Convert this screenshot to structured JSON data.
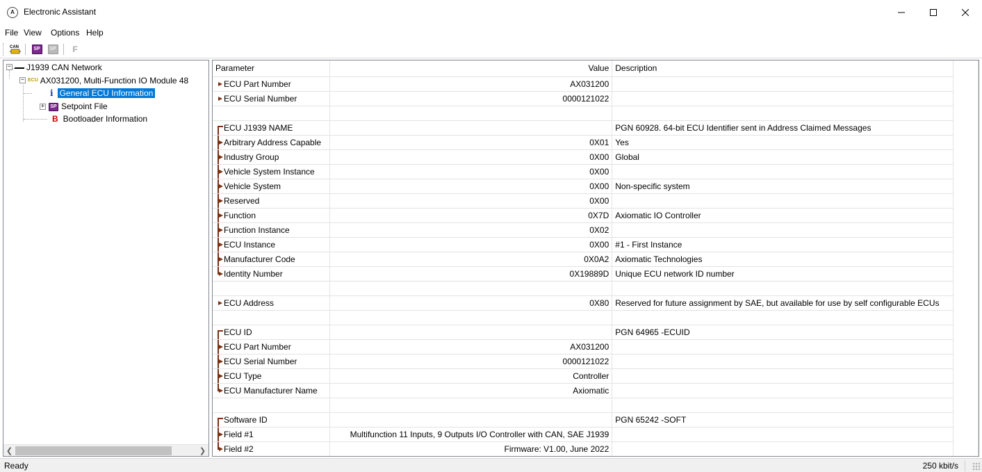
{
  "window": {
    "title": "Electronic Assistant",
    "app_icon": "axiomatic-logo-icon"
  },
  "menu": [
    "File",
    "View",
    "Options",
    "Help"
  ],
  "toolbar": {
    "can_icon_label": "CAN",
    "sp_label": "SP",
    "f_label": "F"
  },
  "tree": {
    "network": "J1939 CAN Network",
    "ecu_tag": "ECU",
    "ecu": "AX031200, Multi-Function IO Module 48",
    "info_icon": "i",
    "general": "General ECU Information",
    "sp_icon": "SP",
    "setpoint": "Setpoint File",
    "boot_icon": "B",
    "bootloader": "Bootloader Information",
    "expand_minus": "−",
    "expand_plus": "+"
  },
  "grid": {
    "headers": {
      "parameter": "Parameter",
      "value": "Value",
      "description": "Description"
    },
    "rows": [
      {
        "marker": "bullet",
        "parameter": "ECU Part Number",
        "value": "AX031200",
        "description": ""
      },
      {
        "marker": "bullet",
        "parameter": "ECU Serial Number",
        "value": "0000121022",
        "description": ""
      },
      {
        "marker": "none",
        "parameter": "",
        "value": "",
        "description": ""
      },
      {
        "marker": "top",
        "parameter": "ECU J1939 NAME",
        "value": "",
        "description": "PGN 60928. 64-bit ECU Identifier sent in Address Claimed Messages"
      },
      {
        "marker": "mid",
        "parameter": "Arbitrary Address Capable",
        "value": "0X01",
        "description": "Yes"
      },
      {
        "marker": "mid",
        "parameter": "Industry Group",
        "value": "0X00",
        "description": "Global"
      },
      {
        "marker": "mid",
        "parameter": "Vehicle System Instance",
        "value": "0X00",
        "description": ""
      },
      {
        "marker": "mid",
        "parameter": "Vehicle System",
        "value": "0X00",
        "description": "Non-specific system"
      },
      {
        "marker": "mid",
        "parameter": "Reserved",
        "value": "0X00",
        "description": ""
      },
      {
        "marker": "mid",
        "parameter": "Function",
        "value": "0X7D",
        "description": "Axiomatic IO Controller"
      },
      {
        "marker": "mid",
        "parameter": "Function Instance",
        "value": "0X02",
        "description": ""
      },
      {
        "marker": "mid",
        "parameter": "ECU Instance",
        "value": "0X00",
        "description": "#1 - First Instance"
      },
      {
        "marker": "mid",
        "parameter": "Manufacturer Code",
        "value": "0X0A2",
        "description": "Axiomatic Technologies"
      },
      {
        "marker": "last",
        "parameter": "Identity Number",
        "value": "0X19889D",
        "description": "Unique ECU network ID number"
      },
      {
        "marker": "none",
        "parameter": "",
        "value": "",
        "description": ""
      },
      {
        "marker": "bullet",
        "parameter": "ECU Address",
        "value": "0X80",
        "description": "Reserved for future assignment by SAE, but available for use by self configurable ECUs"
      },
      {
        "marker": "none",
        "parameter": "",
        "value": "",
        "description": ""
      },
      {
        "marker": "top",
        "parameter": "ECU ID",
        "value": "",
        "description": "PGN 64965   -ECUID"
      },
      {
        "marker": "mid",
        "parameter": "ECU Part Number",
        "value": "AX031200",
        "description": ""
      },
      {
        "marker": "mid",
        "parameter": "ECU Serial Number",
        "value": "0000121022",
        "description": ""
      },
      {
        "marker": "mid",
        "parameter": "ECU Type",
        "value": "Controller",
        "description": ""
      },
      {
        "marker": "last",
        "parameter": "ECU Manufacturer Name",
        "value": "Axiomatic",
        "description": ""
      },
      {
        "marker": "none",
        "parameter": "",
        "value": "",
        "description": ""
      },
      {
        "marker": "top",
        "parameter": "Software ID",
        "value": "",
        "description": "PGN 65242   -SOFT"
      },
      {
        "marker": "mid",
        "parameter": "Field #1",
        "value": "Multifunction 11 Inputs, 9 Outputs I/O Controller with CAN, SAE J1939",
        "description": ""
      },
      {
        "marker": "last",
        "parameter": "Field #2",
        "value": "Firmware: V1.00, June 2022",
        "description": ""
      }
    ]
  },
  "status": {
    "text": "Ready",
    "rate": "250 kbit/s"
  }
}
